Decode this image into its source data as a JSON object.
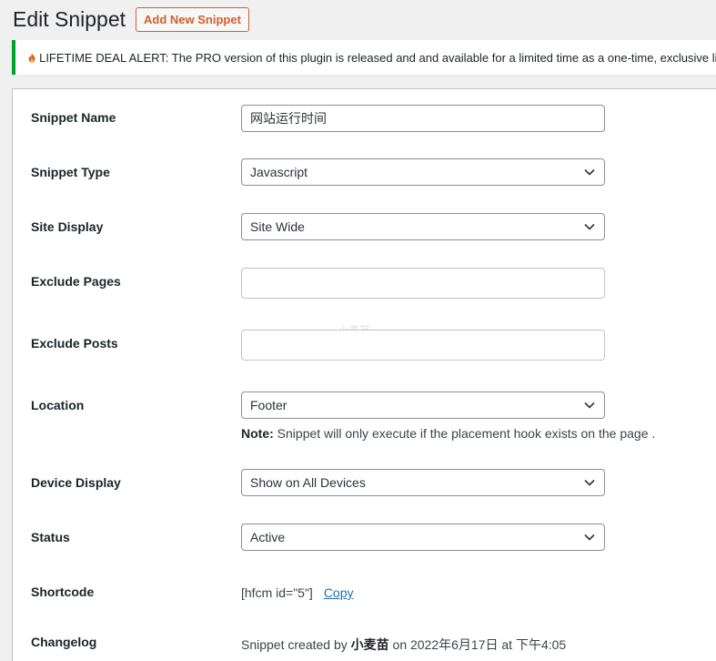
{
  "header": {
    "title": "Edit Snippet",
    "add_new_label": "Add New Snippet"
  },
  "notice": {
    "icon": "fire-icon",
    "text": "LIFETIME DEAL ALERT: The PRO version of this plugin is released and and available for a limited time as a one-time, exclusive lifet",
    "accent_color": "#00a32a"
  },
  "form": {
    "snippet_name": {
      "label": "Snippet Name",
      "value": "网站运行时间"
    },
    "snippet_type": {
      "label": "Snippet Type",
      "value": "Javascript"
    },
    "site_display": {
      "label": "Site Display",
      "value": "Site Wide"
    },
    "exclude_pages": {
      "label": "Exclude Pages",
      "value": ""
    },
    "exclude_posts": {
      "label": "Exclude Posts",
      "value": ""
    },
    "location": {
      "label": "Location",
      "value": "Footer",
      "note_bold": "Note:",
      "note_text": " Snippet will only execute if the placement hook exists on the page ."
    },
    "device_display": {
      "label": "Device Display",
      "value": "Show on All Devices"
    },
    "status": {
      "label": "Status",
      "value": "Active"
    },
    "shortcode": {
      "label": "Shortcode",
      "value": "[hfcm id=\"5\"]",
      "copy_label": "Copy"
    },
    "changelog": {
      "label": "Changelog",
      "prefix": "Snippet created by ",
      "author": "小麦苗",
      "suffix": " on 2022年6月17日 at 下午4:05"
    }
  },
  "watermark": "小麦苗"
}
